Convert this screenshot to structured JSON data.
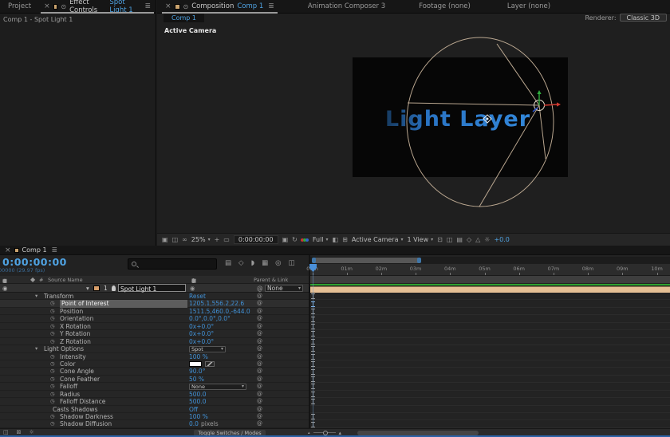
{
  "icons": {
    "close": "×",
    "menu": "≣",
    "chevron_down": "▾",
    "stopwatch": "◷",
    "pickwhip": "@",
    "eye": "◉",
    "gear": "☼",
    "refresh": "↻"
  },
  "top_tabs": {
    "project_label": "Project",
    "effect_controls": {
      "title": "Effect Controls",
      "target": "Spot Light 1"
    },
    "composition": {
      "title": "Composition",
      "target": "Comp 1"
    },
    "animation_composer": "Animation Composer 3",
    "footage": "Footage  (none)",
    "layer": "Layer  (none)"
  },
  "left_panel": {
    "title": "Comp 1 - Spot Light 1"
  },
  "viewer": {
    "tab": "Comp 1",
    "renderer_label": "Renderer:",
    "renderer_value": "Classic 3D",
    "view_label": "Active Camera",
    "comp_text": "Light Layer",
    "toolbar": {
      "zoom": "25%",
      "timecode": "0:00:00:00",
      "resolution": "Full",
      "camera": "Active Camera",
      "views": "1 View",
      "exposure": "+0.0",
      "group1": [
        {
          "name": "always-preview-icon",
          "glyph": "▣"
        },
        {
          "name": "primary-viewer-icon",
          "glyph": "◫"
        },
        {
          "name": "channel-goggles-icon",
          "glyph": "∞"
        }
      ],
      "group2": [
        {
          "name": "selection-crosshair-icon",
          "glyph": "+"
        },
        {
          "name": "region-of-interest-icon",
          "glyph": "▭"
        }
      ],
      "group3": [
        {
          "name": "snapshot-camera-icon",
          "glyph": "▣"
        },
        {
          "name": "show-snapshot-icon",
          "glyph": "↻"
        }
      ],
      "group4": [
        {
          "name": "transparency-grid-icon",
          "glyph": "◧"
        },
        {
          "name": "mask-visibility-icon",
          "glyph": "⊞"
        }
      ],
      "group5": [
        {
          "name": "grid-guides-icon",
          "glyph": "⊡"
        },
        {
          "name": "pixel-aspect-icon",
          "glyph": "◫"
        },
        {
          "name": "flowchart-icon",
          "glyph": "▤"
        },
        {
          "name": "draft-3d-view-icon",
          "glyph": "◇"
        },
        {
          "name": "fast-preview-icon",
          "glyph": "△"
        },
        {
          "name": "adjust-exposure-icon",
          "glyph": "☼"
        }
      ]
    }
  },
  "timeline": {
    "tab": "Comp 1",
    "timecode": "0:00:00:00",
    "frames_info": "00000 (29.97 fps)",
    "source_name_col": "Source Name",
    "index_col": "#",
    "parent_link_col": "Parent & Link",
    "head_icons": [
      {
        "name": "comp-marker-icon",
        "glyph": "▤"
      },
      {
        "name": "draft-3d-icon",
        "glyph": "◇"
      },
      {
        "name": "hide-shy-icon",
        "glyph": "◗"
      },
      {
        "name": "frame-blend-icon",
        "glyph": "▦"
      },
      {
        "name": "motion-blur-icon",
        "glyph": "◎"
      },
      {
        "name": "graph-editor-icon",
        "glyph": "◫"
      }
    ],
    "av_icons": [
      {
        "name": "video-eye-icon",
        "glyph": "◉"
      },
      {
        "name": "audio-icon",
        "glyph": "◀"
      },
      {
        "name": "solo-icon",
        "glyph": "●"
      },
      {
        "name": "lock-icon",
        "glyph": "▣"
      }
    ],
    "switch_icons": [
      {
        "name": "av-features-icon",
        "glyph": "◉"
      },
      {
        "name": "blend-mode-icon",
        "glyph": "◈"
      },
      {
        "name": "shy-icon",
        "glyph": "\\"
      },
      {
        "name": "collapse-transform-icon",
        "glyph": "fx"
      },
      {
        "name": "mask-icon",
        "glyph": "▦"
      },
      {
        "name": "effect-icon",
        "glyph": "∅"
      },
      {
        "name": "quality-icon",
        "glyph": "◐"
      },
      {
        "name": "motion-blur-col-icon",
        "glyph": "⊙"
      }
    ],
    "layer": {
      "index": "1",
      "name": "Spot Light 1",
      "parent": "None"
    },
    "rows": [
      {
        "name": "Transform",
        "kind": "group",
        "vtype": "link",
        "value": "Reset",
        "marker": true
      },
      {
        "name": "Point of Interest",
        "kind": "prop",
        "vtype": "text",
        "value": "1205.1,556.2,22.6",
        "selected": true,
        "marker": true
      },
      {
        "name": "Position",
        "kind": "prop",
        "vtype": "text",
        "value": "1511.5,460.0,-644.0",
        "marker": true
      },
      {
        "name": "Orientation",
        "kind": "prop",
        "vtype": "text",
        "value": "0.0°,0.0°,0.0°",
        "marker": true
      },
      {
        "name": "X Rotation",
        "kind": "prop",
        "vtype": "text",
        "value": "0x+0.0°",
        "marker": true
      },
      {
        "name": "Y Rotation",
        "kind": "prop",
        "vtype": "text",
        "value": "0x+0.0°",
        "marker": true
      },
      {
        "name": "Z Rotation",
        "kind": "prop",
        "vtype": "text",
        "value": "0x+0.0°",
        "marker": true
      },
      {
        "name": "Light Options",
        "kind": "group",
        "vtype": "dropdown",
        "value": "Spot",
        "dd_width": 46,
        "marker": true
      },
      {
        "name": "Intensity",
        "kind": "prop",
        "vtype": "text",
        "value": "100 %",
        "marker": true
      },
      {
        "name": "Color",
        "kind": "prop",
        "vtype": "swatch",
        "value": "#ffffff",
        "marker": true
      },
      {
        "name": "Cone Angle",
        "kind": "prop",
        "vtype": "text",
        "value": "90.0°",
        "marker": true
      },
      {
        "name": "Cone Feather",
        "kind": "prop",
        "vtype": "text",
        "value": "50 %",
        "marker": true
      },
      {
        "name": "Falloff",
        "kind": "prop",
        "vtype": "dropdown",
        "value": "None",
        "dd_width": 72,
        "marker": true
      },
      {
        "name": "Radius",
        "kind": "prop",
        "vtype": "text",
        "value": "500.0",
        "marker": true
      },
      {
        "name": "Falloff Distance",
        "kind": "prop",
        "vtype": "text",
        "value": "500.0",
        "marker": true
      },
      {
        "name": "Casts Shadows",
        "kind": "plain",
        "vtype": "text",
        "value": "Off",
        "marker": false
      },
      {
        "name": "Shadow Darkness",
        "kind": "prop",
        "vtype": "text",
        "value": "100 %",
        "marker": true
      },
      {
        "name": "Shadow Diffusion",
        "kind": "prop",
        "vtype": "text",
        "value": "0.0",
        "suffix": "pixels",
        "marker": true
      }
    ],
    "ruler": {
      "labels": [
        "00m",
        "01m",
        "02m",
        "03m",
        "04m",
        "05m",
        "06m",
        "07m",
        "08m",
        "09m",
        "10m"
      ]
    },
    "bottom": {
      "toggle_label": "Toggle Switches / Modes",
      "left_icons": [
        {
          "name": "frame-blend-toggle-icon",
          "glyph": "◫"
        },
        {
          "name": "motion-blur-toggle-icon",
          "glyph": "⊠"
        },
        {
          "name": "brainstorm-icon",
          "glyph": "☼"
        }
      ]
    }
  }
}
